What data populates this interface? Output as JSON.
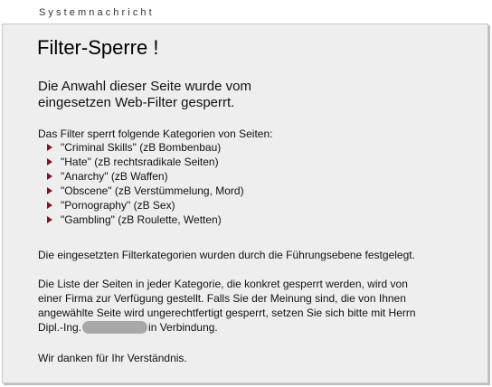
{
  "header": {
    "label": "Systemnachricht"
  },
  "main": {
    "title": "Filter-Sperre !",
    "intro_line1": "Die Anwahl dieser Seite wurde vom",
    "intro_line2": "eingesetzen Web-Filter gesperrt.",
    "categories_intro": "Das Filter sperrt folgende Kategorien von Seiten:",
    "categories": [
      "\"Criminal Skills\" (zB Bombenbau)",
      "\"Hate\" (zB rechtsradikale Seiten)",
      "\"Anarchy\" (zB Waffen)",
      "\"Obscene\" (zB Verstümmelung, Mord)",
      "\"Pornography\" (zB Sex)",
      "\"Gambling\" (zB Roulette, Wetten)"
    ],
    "management_note": "Die eingesetzten Filterkategorien wurden durch die Führungsebene festgelegt.",
    "list_info_line1": "Die Liste der Seiten in jeder Kategorie, die konkret gesperrt werden, wird von",
    "list_info_line2": "einer Firma zur Verfügung gestellt. Falls Sie der Meinung sind, die von Ihnen",
    "list_info_line3": "angewählte Seite wird ungerechtfertigt gesperrt, setzen Sie sich bitte mit Herrn",
    "list_info_line4_prefix": "Dipl.-Ing.",
    "list_info_line4_suffix": "in Verbindung.",
    "thanks": "Wir danken für Ihr Verständnis."
  },
  "colors": {
    "panel_background": "#eeeeee",
    "bullet_arrow": "#7a1630"
  },
  "icons": {
    "bullet": "triangle-right-icon"
  }
}
